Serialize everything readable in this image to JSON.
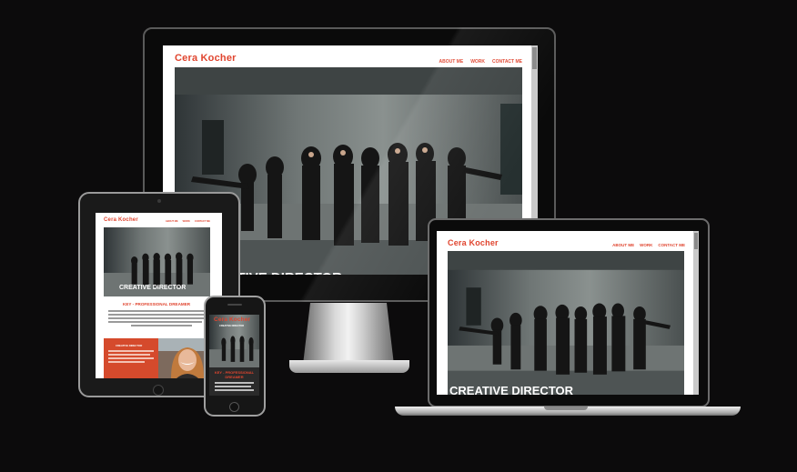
{
  "site": {
    "brand": "Cera Kocher",
    "nav": [
      "ABOUT ME",
      "WORK",
      "CONTACT ME"
    ],
    "hero_title": "CREATIVE DIRECTOR",
    "section_heading": "KEY - PROFESSIONAL DREAMER",
    "phone_section_heading": "KEY - PROFESSIONAL DREAMER",
    "card_heading": "CREATIVE DIRECTOR"
  },
  "colors": {
    "accent": "#e0452f",
    "card": "#d54a2c",
    "background": "#0c0b0c"
  },
  "devices": [
    "desktop-monitor",
    "laptop",
    "tablet",
    "phone"
  ]
}
